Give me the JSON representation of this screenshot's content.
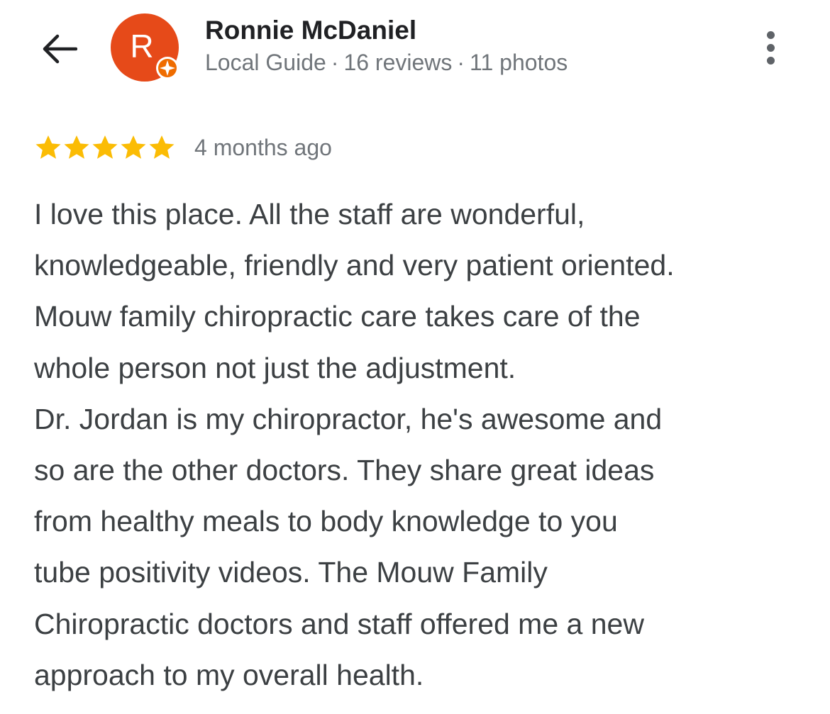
{
  "header": {
    "back_icon": "arrow-back-icon",
    "more_icon": "more-vert-icon"
  },
  "reviewer": {
    "avatar_letter": "R",
    "avatar_color": "#e64a19",
    "badge_icon": "local-guide-badge-icon",
    "badge_color": "#ef6c00",
    "name": "Ronnie McDaniel",
    "level": "Local Guide",
    "reviews": "16 reviews",
    "photos": "11 photos",
    "separator": "·"
  },
  "review": {
    "rating": 5,
    "rating_max": 5,
    "star_color": "#fbbc04",
    "date": "4 months ago",
    "lines": [
      "I love this place. All the staff are wonderful,",
      "knowledgeable, friendly and very patient oriented.",
      "Mouw family chiropractic care takes care of the",
      "whole person not just the adjustment.",
      "Dr. Jordan is my chiropractor, he's awesome and",
      "so are the other doctors. They share great ideas",
      "from healthy meals to body knowledge to you",
      "tube positivity videos. The Mouw Family",
      "Chiropractic doctors and staff offered me a new",
      "approach to my overall health."
    ]
  }
}
